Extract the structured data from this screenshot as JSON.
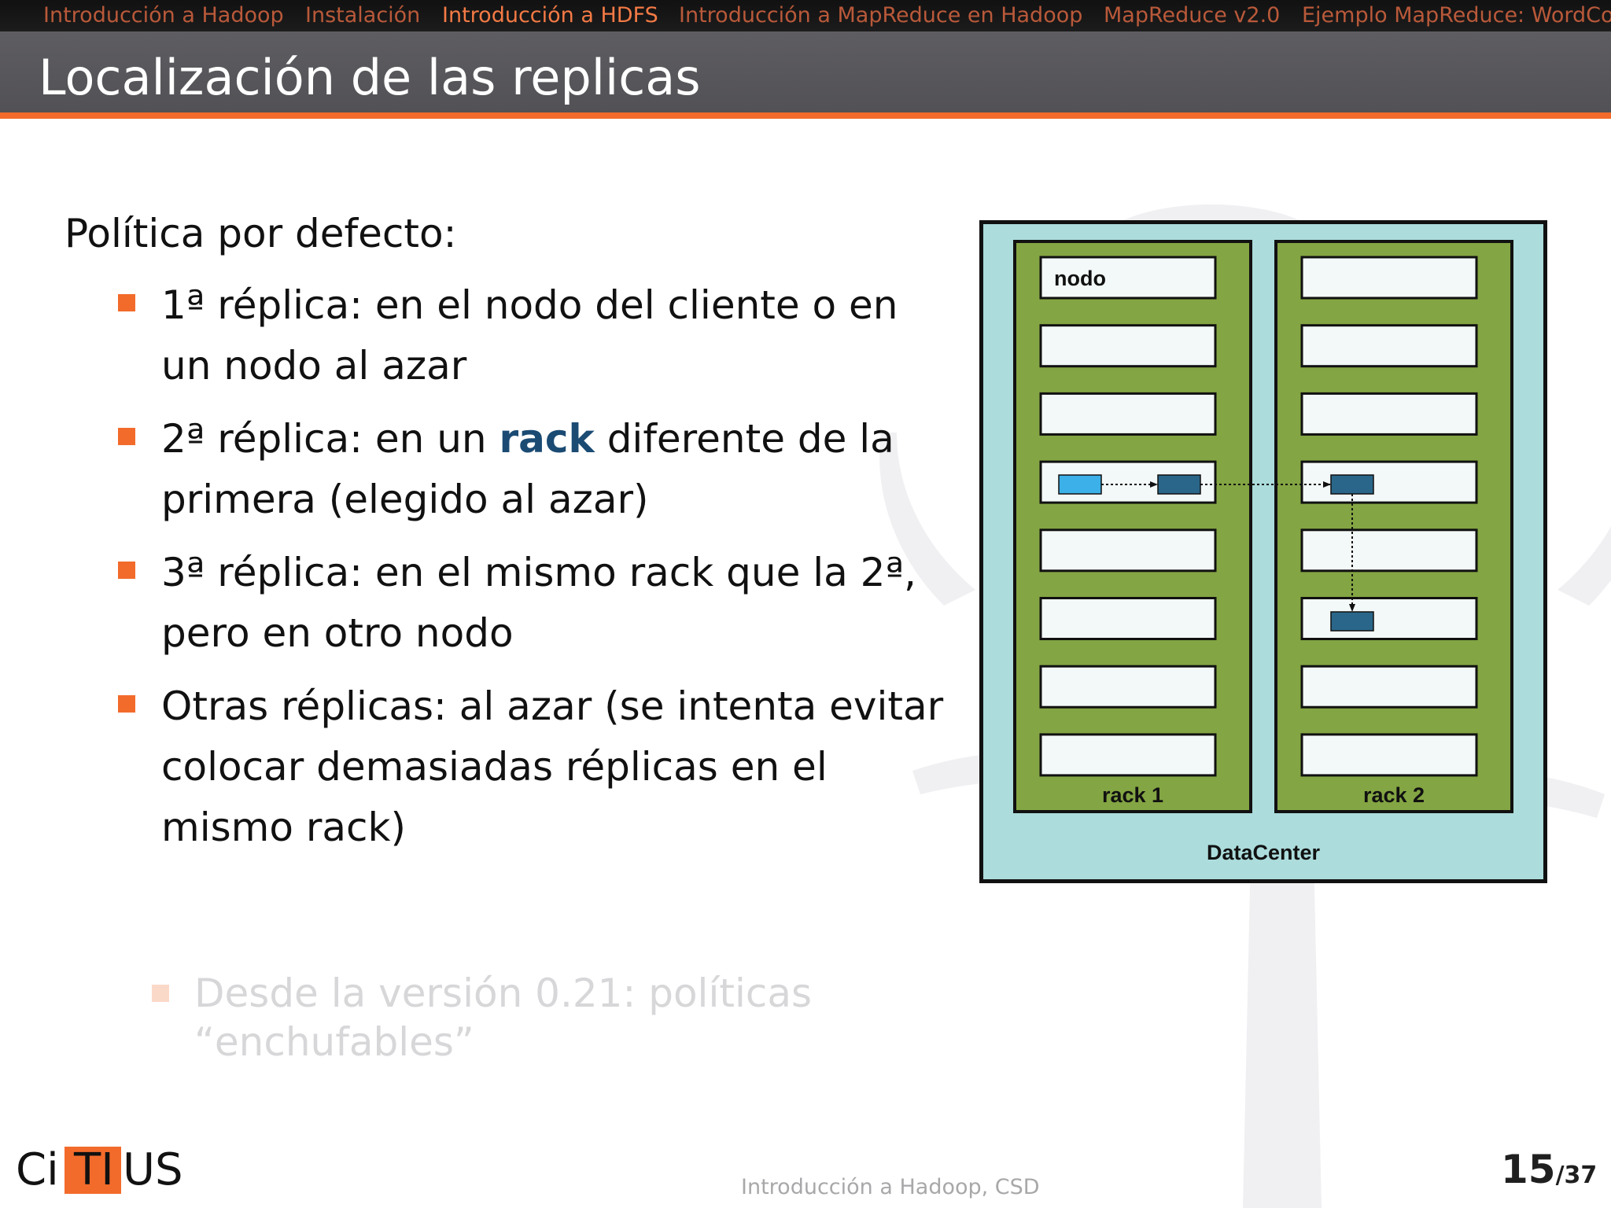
{
  "nav": {
    "items": [
      {
        "label": "Introducción a Hadoop"
      },
      {
        "label": "Instalación"
      },
      {
        "label": "Introducción a HDFS"
      },
      {
        "label": "Introducción a MapReduce en Hadoop"
      },
      {
        "label": "MapReduce v2.0"
      },
      {
        "label": "Ejemplo MapReduce: WordCount"
      }
    ],
    "active_index": 2
  },
  "slide": {
    "title": "Localización de las replicas",
    "policy_heading": "Política por defecto:",
    "bullets": [
      {
        "text": "1ª réplica: en el nodo del cliente o en un nodo al azar"
      },
      {
        "before": "2ª réplica: en un ",
        "keyword": "rack",
        "after": " diferente de la primera (elegido al azar)"
      },
      {
        "text": "3ª réplica: en el mismo rack que la 2ª, pero en otro nodo"
      },
      {
        "text": "Otras réplicas: al azar (se intenta evitar colocar demasiadas réplicas en el mismo rack)"
      }
    ],
    "faded_bullet": "Desde la versión 0.21: políticas “enchufables”"
  },
  "diagram": {
    "node_label": "nodo",
    "rack1_label": "rack 1",
    "rack2_label": "rack 2",
    "datacenter_label": "DataCenter",
    "nodes_per_rack": 8,
    "colors": {
      "datacenter": "#acdcdc",
      "rack": "#83a543",
      "node": "#f3f9f8",
      "first_replica": "#3cb0e8",
      "replica": "#2a6689"
    }
  },
  "footer": {
    "logo": {
      "left": "Ci",
      "box": "TI",
      "right": "US"
    },
    "center_text": "Introducción a Hadoop, CSD",
    "page_current": "15",
    "page_total": "/37"
  },
  "colors": {
    "accent": "#f26b2b",
    "title_bar": "#58575b",
    "nav_inactive": "#b9593a",
    "nav_active": "#f47a45",
    "keyword": "#1b4b73"
  }
}
